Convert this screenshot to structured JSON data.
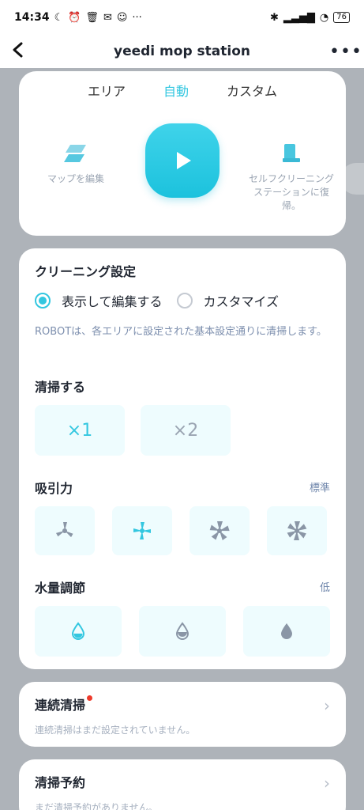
{
  "status": {
    "time": "14:34",
    "left_icons": [
      "moon-icon",
      "alarm-icon",
      "trash-icon",
      "mail-icon",
      "face-icon",
      "more-dots"
    ],
    "battery": "76"
  },
  "header": {
    "title": "yeedi mop station",
    "back_icon": "chevron-left-icon",
    "more_icon": "more-horizontal-icon"
  },
  "mode": {
    "tabs": [
      {
        "label": "エリア",
        "active": false
      },
      {
        "label": "自動",
        "active": true
      },
      {
        "label": "カスタム",
        "active": false
      }
    ],
    "edit_map": "マップを編集",
    "return_station": "セルフクリーニングステーションに復帰。"
  },
  "cleaning": {
    "title": "クリーニング設定",
    "options": [
      {
        "label": "表示して編集する",
        "selected": true
      },
      {
        "label": "カスタマイズ",
        "selected": false
      }
    ],
    "description": "ROBOTは、各エリアに設定された基本設定通りに清掃します。",
    "passes": {
      "title": "清掃する",
      "items": [
        "×1",
        "×2"
      ],
      "selected": 0
    },
    "suction": {
      "title": "吸引力",
      "value": "標準",
      "levels": 4,
      "selected": 1
    },
    "water": {
      "title": "水量調節",
      "value": "低",
      "levels": 3,
      "selected": 0
    }
  },
  "continuous": {
    "title": "連続清掃",
    "subtitle": "連続清掃はまだ設定されていません。"
  },
  "schedule": {
    "title": "清掃予約",
    "subtitle": "まだ清掃予約がありません。"
  },
  "colors": {
    "accent": "#33c7e0",
    "muted": "#7d8fae",
    "tile": "#eefcfe"
  }
}
